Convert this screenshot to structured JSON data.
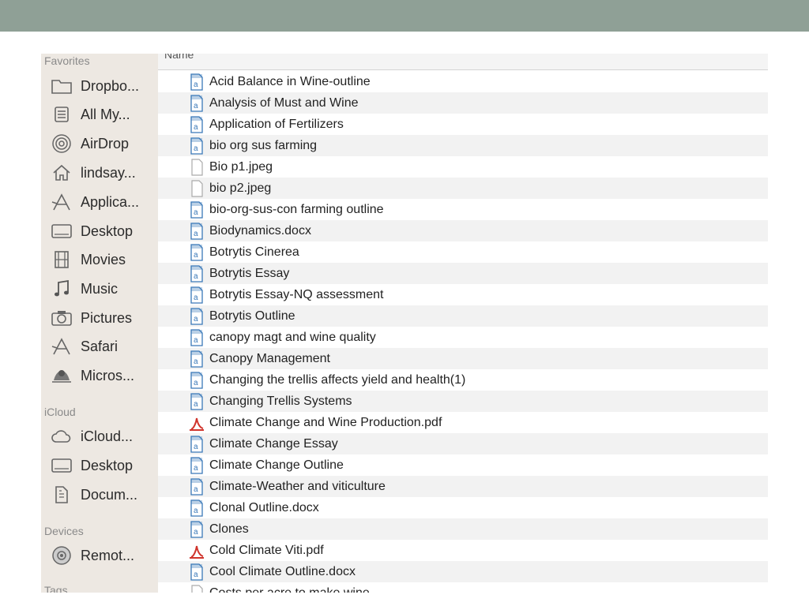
{
  "sidebar": {
    "sections": {
      "favorites": "Favorites",
      "icloud": "iCloud",
      "devices": "Devices",
      "tags": "Tags"
    },
    "favorites": [
      {
        "label": "Dropbo...",
        "icon": "folder-icon"
      },
      {
        "label": "All My...",
        "icon": "all-my-files-icon"
      },
      {
        "label": "AirDrop",
        "icon": "airdrop-icon"
      },
      {
        "label": "lindsay...",
        "icon": "home-icon"
      },
      {
        "label": "Applica...",
        "icon": "applications-icon"
      },
      {
        "label": "Desktop",
        "icon": "desktop-icon"
      },
      {
        "label": "Movies",
        "icon": "movies-icon"
      },
      {
        "label": "Music",
        "icon": "music-icon"
      },
      {
        "label": "Pictures",
        "icon": "camera-icon"
      },
      {
        "label": "Safari",
        "icon": "safari-icon"
      },
      {
        "label": "Micros...",
        "icon": "microsoft-icon"
      }
    ],
    "icloud": [
      {
        "label": "iCloud...",
        "icon": "cloud-icon"
      },
      {
        "label": "Desktop",
        "icon": "desktop-icon"
      },
      {
        "label": "Docum...",
        "icon": "documents-icon"
      }
    ],
    "devices": [
      {
        "label": "Remot...",
        "icon": "disc-icon"
      }
    ]
  },
  "list": {
    "column_name": "Name",
    "files": [
      {
        "name": "Acid Balance in Wine-outline",
        "type": "doc"
      },
      {
        "name": "Analysis of Must and Wine",
        "type": "doc"
      },
      {
        "name": "Application of Fertilizers",
        "type": "doc"
      },
      {
        "name": "bio org sus farming",
        "type": "doc"
      },
      {
        "name": "Bio p1.jpeg",
        "type": "blank"
      },
      {
        "name": "bio p2.jpeg",
        "type": "blank"
      },
      {
        "name": "bio-org-sus-con farming outline",
        "type": "doc"
      },
      {
        "name": "Biodynamics.docx",
        "type": "doc"
      },
      {
        "name": "Botrytis Cinerea",
        "type": "doc"
      },
      {
        "name": "Botrytis Essay",
        "type": "doc"
      },
      {
        "name": "Botrytis Essay-NQ assessment",
        "type": "doc"
      },
      {
        "name": "Botrytis Outline",
        "type": "doc"
      },
      {
        "name": "canopy magt and wine quality",
        "type": "doc"
      },
      {
        "name": "Canopy Management",
        "type": "doc"
      },
      {
        "name": "Changing the trellis affects yield and health(1)",
        "type": "doc"
      },
      {
        "name": "Changing Trellis Systems",
        "type": "doc"
      },
      {
        "name": "Climate Change and Wine Production.pdf",
        "type": "pdf"
      },
      {
        "name": "Climate Change Essay",
        "type": "doc"
      },
      {
        "name": "Climate Change Outline",
        "type": "doc"
      },
      {
        "name": "Climate-Weather and viticulture",
        "type": "doc"
      },
      {
        "name": "Clonal Outline.docx",
        "type": "doc"
      },
      {
        "name": "Clones",
        "type": "doc"
      },
      {
        "name": "Cold Climate Viti.pdf",
        "type": "pdf"
      },
      {
        "name": "Cool Climate Outline.docx",
        "type": "doc"
      },
      {
        "name": "Costs per acre to make wine",
        "type": "blank"
      }
    ]
  },
  "colors": {
    "topbar": "#8fa096",
    "sidebar": "#ede8e2",
    "doc_icon": "#3a78b8",
    "pdf_icon": "#d0342c"
  }
}
